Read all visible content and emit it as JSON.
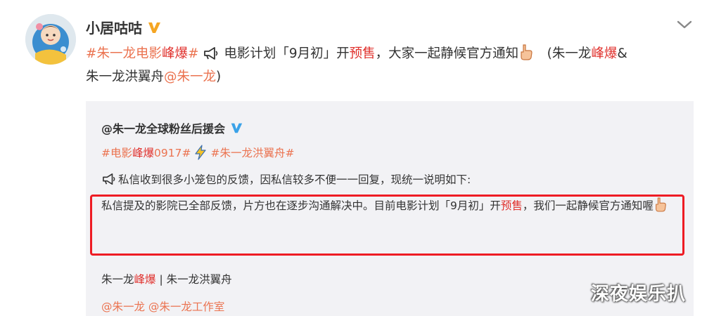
{
  "post": {
    "username": "小居咕咕",
    "hashtag": "#朱一龙电影",
    "hashtag_hot": "峰爆",
    "hashtag_end": "#",
    "text_a": " 电影计划「9月初」开",
    "text_presale": "预售",
    "text_b": "，大家一起静候官方通知",
    "text_c": "　(朱一龙",
    "text_hot": "峰爆",
    "text_d": "&",
    "text_e": "朱一龙洪翼舟",
    "mention": "@朱一龙",
    "text_f": ")"
  },
  "quote": {
    "author": "@朱一龙全球粉丝后援会",
    "tag1_a": "#电影",
    "tag1_hot": "峰爆",
    "tag1_b": "0917#",
    "tag2": "#朱一龙洪翼舟#",
    "line1": "私信收到很多小笼包的反馈，因私信较多不便一一回复，现统一说明如下:",
    "para_a": "私信提及的影院已全部反馈，片方也在逐步沟通解决中。目前电影计划「9月初」开",
    "para_presale": "预售",
    "para_b": "，我们一起静候官方通知喔",
    "foot1_a": "朱一龙",
    "foot1_hot": "峰爆",
    "foot1_b": " | 朱一龙洪翼舟",
    "foot2": "@朱一龙 @朱一龙工作室"
  },
  "watermark": "深夜娱乐扒",
  "icons": {
    "verified": "verified-badge-icon",
    "megaphone": "megaphone-icon",
    "hand": "pointing-hand-icon",
    "lightning": "lightning-icon",
    "chevron": "chevron-down-icon"
  },
  "colors": {
    "link": "#eb7350",
    "hot": "#e0312d",
    "quote_bg": "#f2f2f5",
    "highlight_box": "#ee1c24",
    "verified_badge": "#f5a623",
    "verified_badge_quote": "#3aa2e8"
  }
}
